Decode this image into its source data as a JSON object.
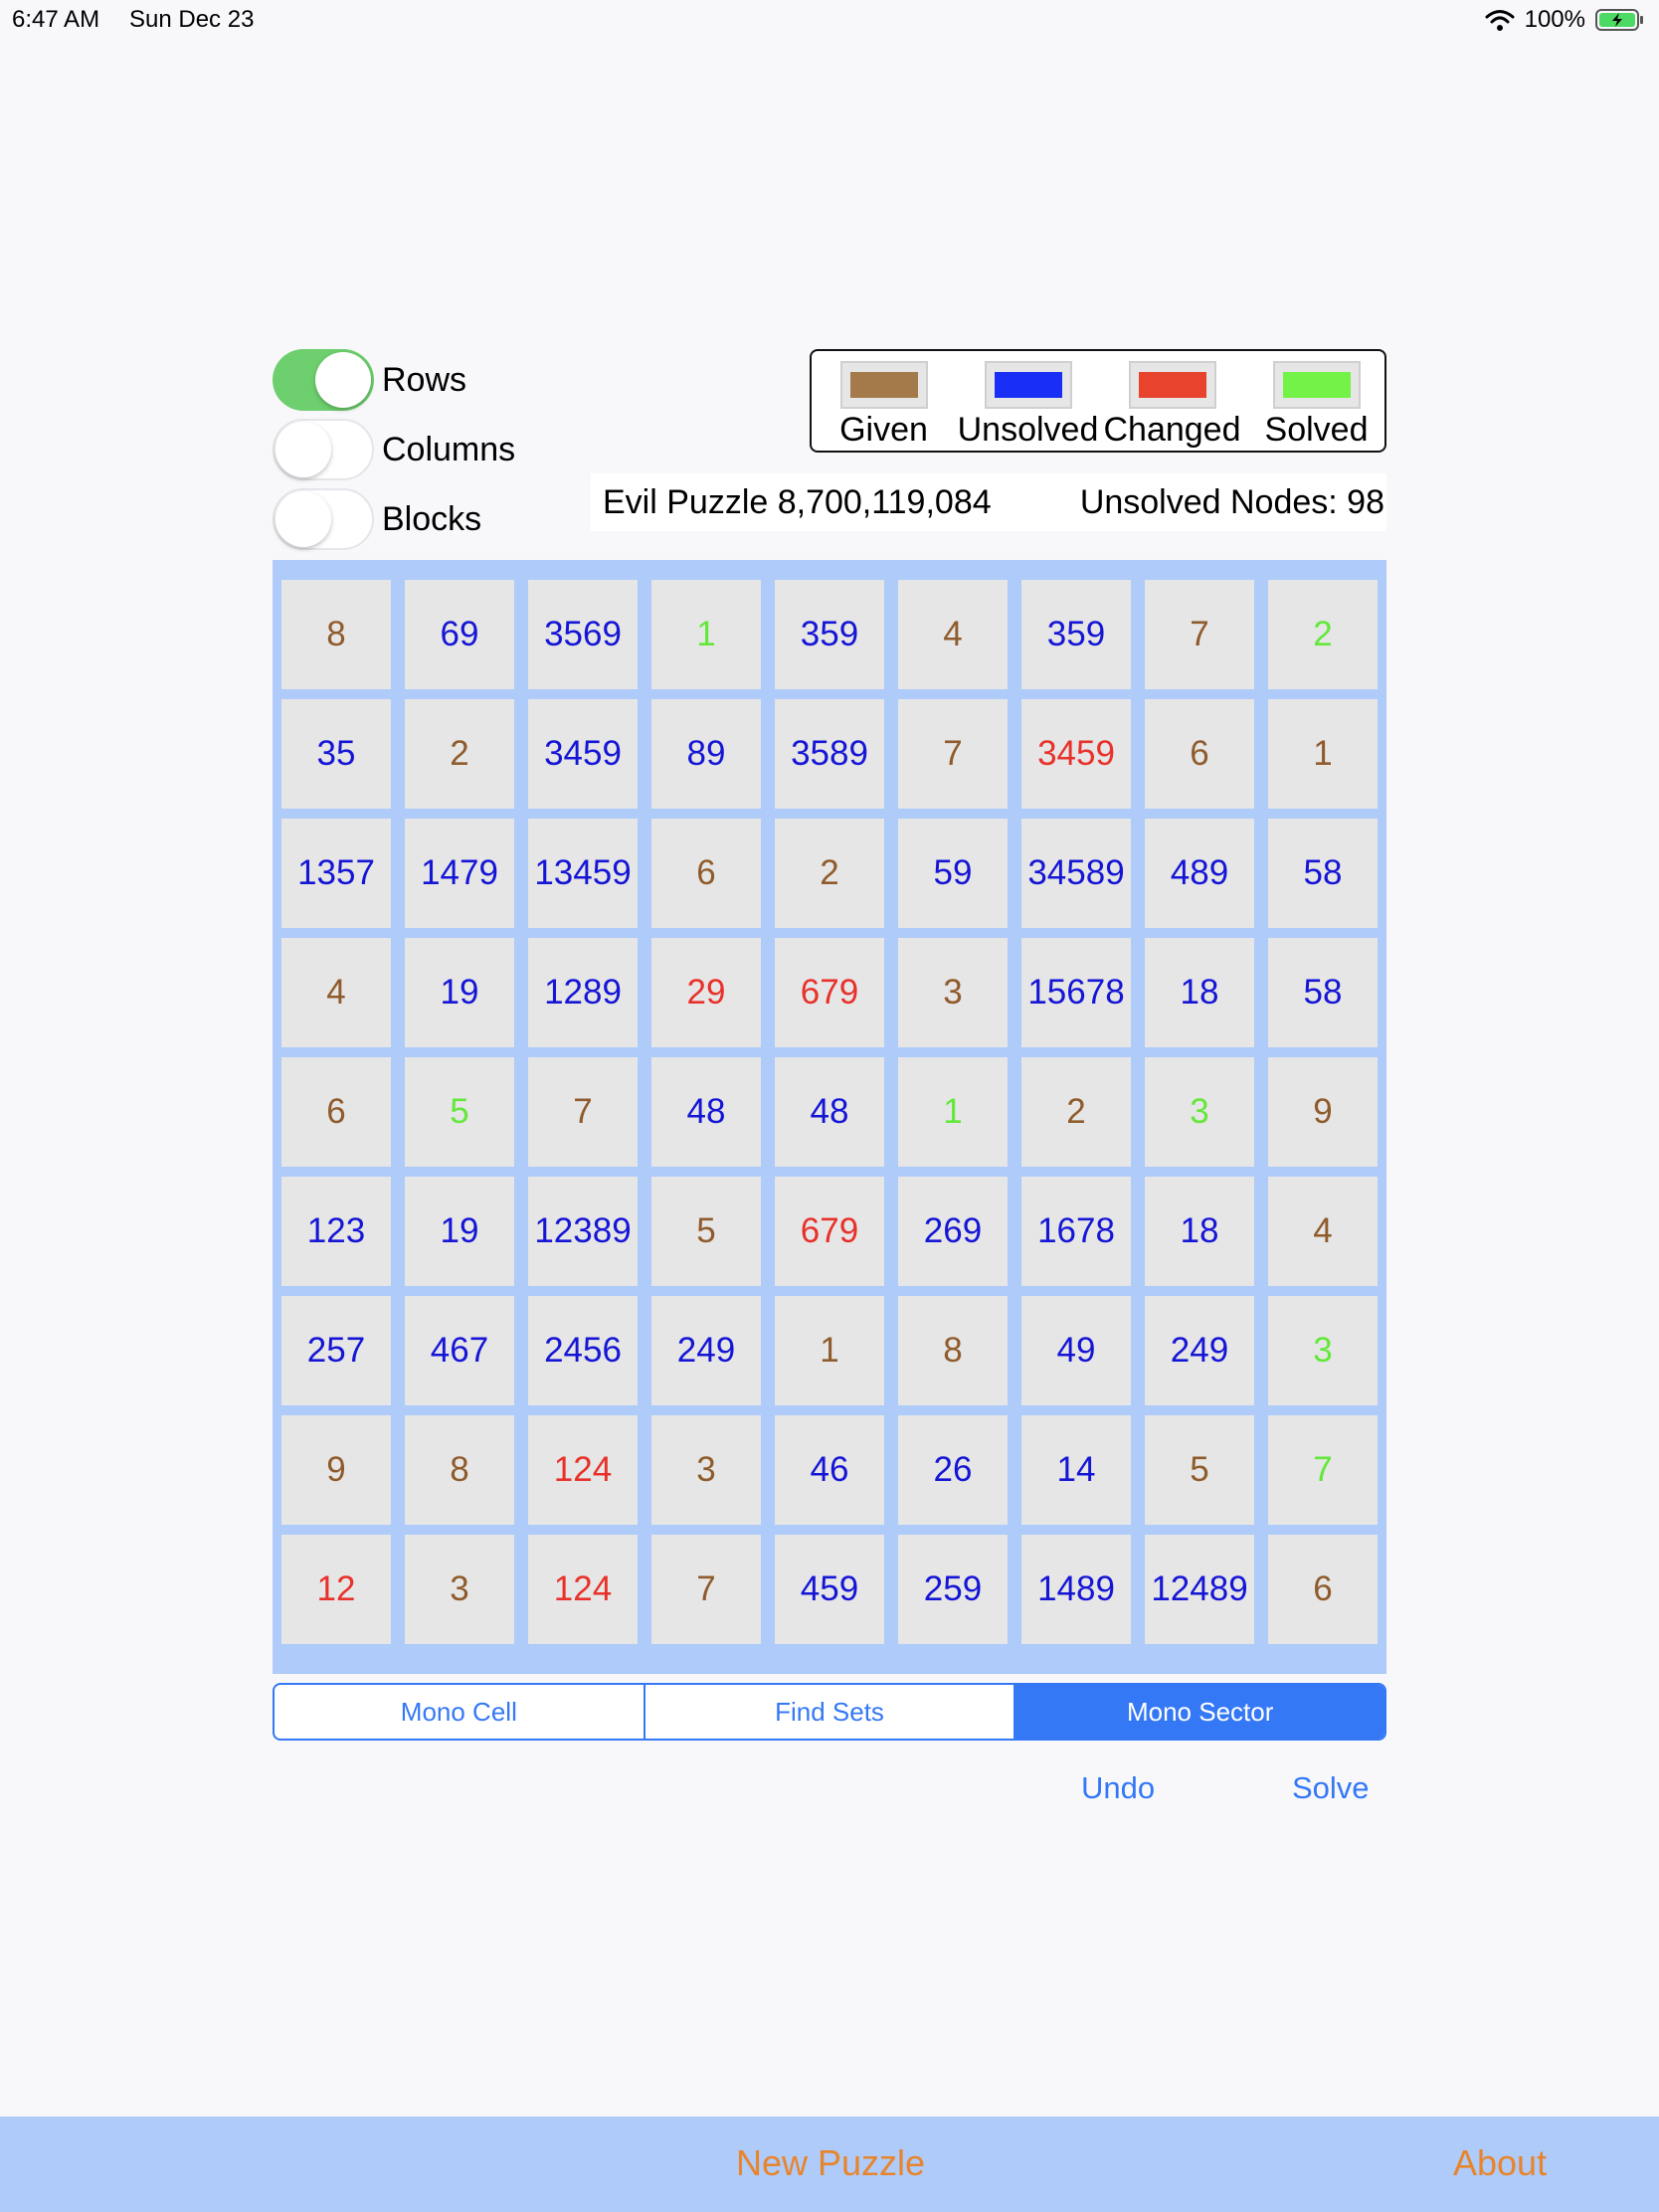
{
  "status_bar": {
    "time": "6:47 AM",
    "date": "Sun Dec 23",
    "battery": "100%"
  },
  "toggles": [
    {
      "label": "Rows",
      "on": true
    },
    {
      "label": "Columns",
      "on": false
    },
    {
      "label": "Blocks",
      "on": false
    }
  ],
  "legend": [
    {
      "label": "Given",
      "color": "#a47a4a"
    },
    {
      "label": "Unsolved",
      "color": "#1a2ff5"
    },
    {
      "label": "Changed",
      "color": "#e8432c"
    },
    {
      "label": "Solved",
      "color": "#73f247"
    }
  ],
  "info": {
    "puzzle": "Evil Puzzle 8,700,119,084",
    "unsolved": "Unsolved Nodes: 98"
  },
  "board": [
    [
      [
        "8",
        "given"
      ],
      [
        "69",
        "unsolved"
      ],
      [
        "3569",
        "unsolved"
      ],
      [
        "1",
        "solved"
      ],
      [
        "359",
        "unsolved"
      ],
      [
        "4",
        "given"
      ],
      [
        "359",
        "unsolved"
      ],
      [
        "7",
        "given"
      ],
      [
        "2",
        "solved"
      ]
    ],
    [
      [
        "35",
        "unsolved"
      ],
      [
        "2",
        "given"
      ],
      [
        "3459",
        "unsolved"
      ],
      [
        "89",
        "unsolved"
      ],
      [
        "3589",
        "unsolved"
      ],
      [
        "7",
        "given"
      ],
      [
        "3459",
        "changed"
      ],
      [
        "6",
        "given"
      ],
      [
        "1",
        "given"
      ]
    ],
    [
      [
        "1357",
        "unsolved"
      ],
      [
        "1479",
        "unsolved"
      ],
      [
        "13459",
        "unsolved"
      ],
      [
        "6",
        "given"
      ],
      [
        "2",
        "given"
      ],
      [
        "59",
        "unsolved"
      ],
      [
        "34589",
        "unsolved"
      ],
      [
        "489",
        "unsolved"
      ],
      [
        "58",
        "unsolved"
      ]
    ],
    [
      [
        "4",
        "given"
      ],
      [
        "19",
        "unsolved"
      ],
      [
        "1289",
        "unsolved"
      ],
      [
        "29",
        "changed"
      ],
      [
        "679",
        "changed"
      ],
      [
        "3",
        "given"
      ],
      [
        "15678",
        "unsolved"
      ],
      [
        "18",
        "unsolved"
      ],
      [
        "58",
        "unsolved"
      ]
    ],
    [
      [
        "6",
        "given"
      ],
      [
        "5",
        "solved"
      ],
      [
        "7",
        "given"
      ],
      [
        "48",
        "unsolved"
      ],
      [
        "48",
        "unsolved"
      ],
      [
        "1",
        "solved"
      ],
      [
        "2",
        "given"
      ],
      [
        "3",
        "solved"
      ],
      [
        "9",
        "given"
      ]
    ],
    [
      [
        "123",
        "unsolved"
      ],
      [
        "19",
        "unsolved"
      ],
      [
        "12389",
        "unsolved"
      ],
      [
        "5",
        "given"
      ],
      [
        "679",
        "changed"
      ],
      [
        "269",
        "unsolved"
      ],
      [
        "1678",
        "unsolved"
      ],
      [
        "18",
        "unsolved"
      ],
      [
        "4",
        "given"
      ]
    ],
    [
      [
        "257",
        "unsolved"
      ],
      [
        "467",
        "unsolved"
      ],
      [
        "2456",
        "unsolved"
      ],
      [
        "249",
        "unsolved"
      ],
      [
        "1",
        "given"
      ],
      [
        "8",
        "given"
      ],
      [
        "49",
        "unsolved"
      ],
      [
        "249",
        "unsolved"
      ],
      [
        "3",
        "solved"
      ]
    ],
    [
      [
        "9",
        "given"
      ],
      [
        "8",
        "given"
      ],
      [
        "124",
        "changed"
      ],
      [
        "3",
        "given"
      ],
      [
        "46",
        "unsolved"
      ],
      [
        "26",
        "unsolved"
      ],
      [
        "14",
        "unsolved"
      ],
      [
        "5",
        "given"
      ],
      [
        "7",
        "solved"
      ]
    ],
    [
      [
        "12",
        "changed"
      ],
      [
        "3",
        "given"
      ],
      [
        "124",
        "changed"
      ],
      [
        "7",
        "given"
      ],
      [
        "459",
        "unsolved"
      ],
      [
        "259",
        "unsolved"
      ],
      [
        "1489",
        "unsolved"
      ],
      [
        "12489",
        "unsolved"
      ],
      [
        "6",
        "given"
      ]
    ]
  ],
  "segments": [
    {
      "label": "Mono Cell",
      "selected": false
    },
    {
      "label": "Find Sets",
      "selected": false
    },
    {
      "label": "Mono Sector",
      "selected": true
    }
  ],
  "actions": {
    "undo": "Undo",
    "solve": "Solve"
  },
  "bottom_bar": {
    "new_puzzle": "New Puzzle",
    "about": "About"
  }
}
